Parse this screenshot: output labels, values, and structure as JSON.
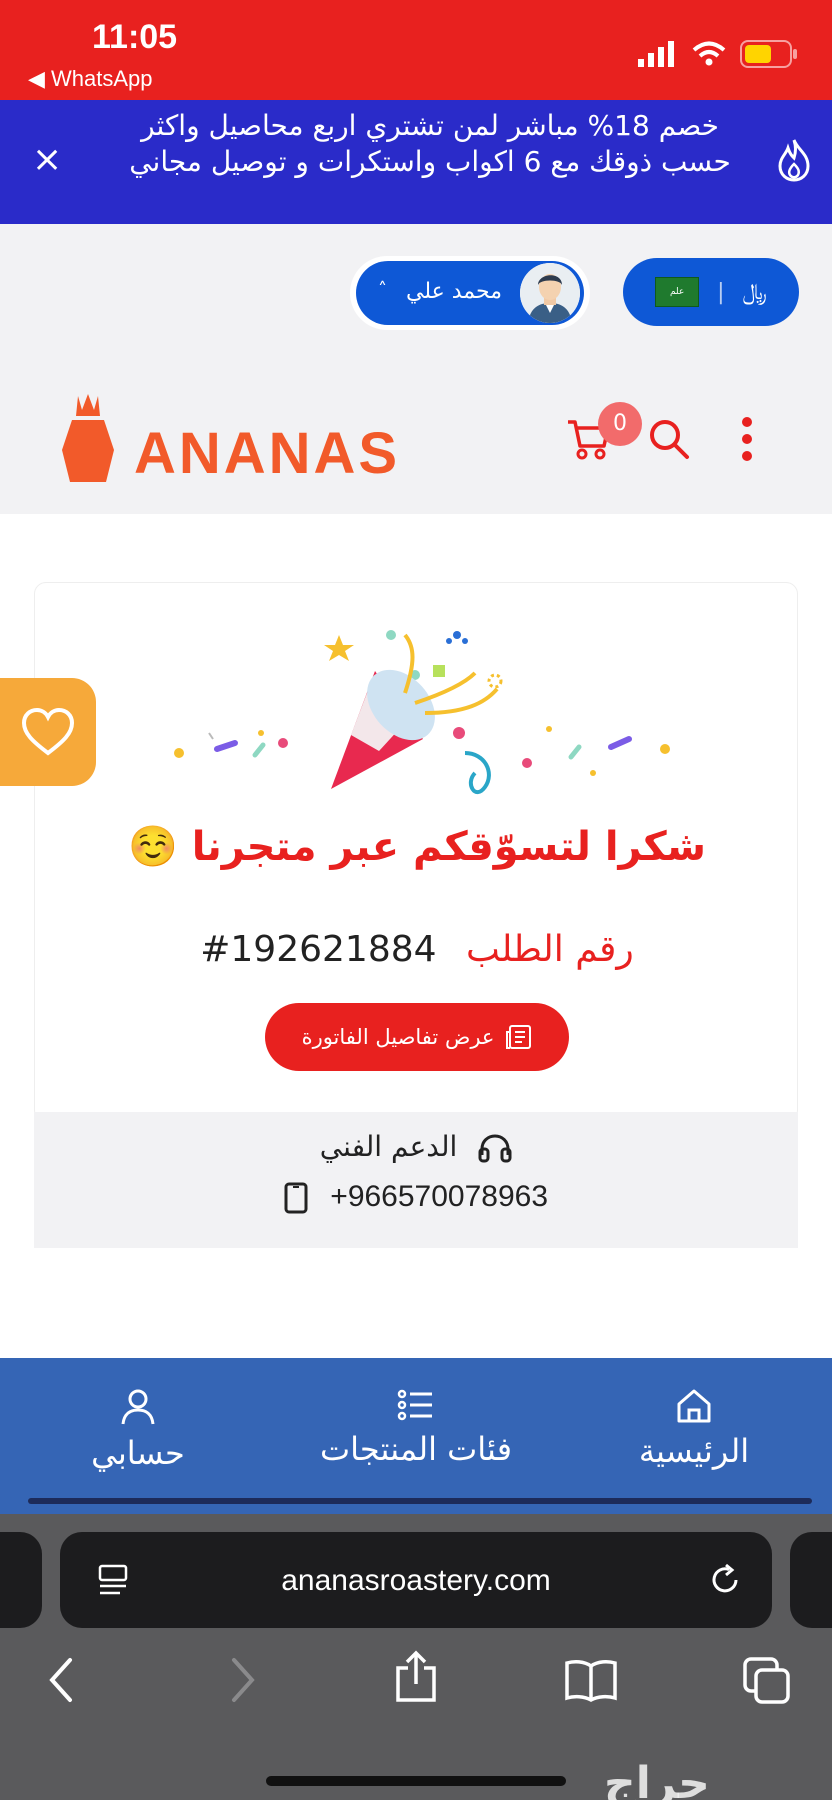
{
  "status_bar": {
    "time": "11:05",
    "back_label": "◀ WhatsApp"
  },
  "promo": {
    "text": "خصم 18% مباشر لمن تشتري اربع محاصيل واكثر حسب ذوقك مع 6 اكواب واستكرات و توصيل مجاني",
    "close_label": "×"
  },
  "account": {
    "currency": "﷼",
    "flag_text": "علم",
    "user_name": "محمد علي",
    "chevron": "˄"
  },
  "header": {
    "brand": "ANANAS",
    "cart_count": "0"
  },
  "order": {
    "thanks": "شكرا لتسوّقكم عبر متجرنا ☺️",
    "order_label": "رقم الطلب",
    "order_number": "#192621884",
    "invoice_button": "عرض تفاصيل الفاتورة"
  },
  "support": {
    "title": "الدعم الفني",
    "phone": "+966570078963"
  },
  "bottom_nav": {
    "home": "الرئيسية",
    "categories": "فئات المنتجات",
    "account": "حسابي"
  },
  "browser": {
    "url": "ananasroastery.com"
  },
  "watermark": "حراج",
  "colors": {
    "primary_red": "#e8211f",
    "promo_blue": "#2a2bc9",
    "pill_blue": "#0e58d6",
    "brand_orange": "#f25a2a",
    "nav_blue": "#3565b5",
    "fav_orange": "#f6a93a"
  }
}
